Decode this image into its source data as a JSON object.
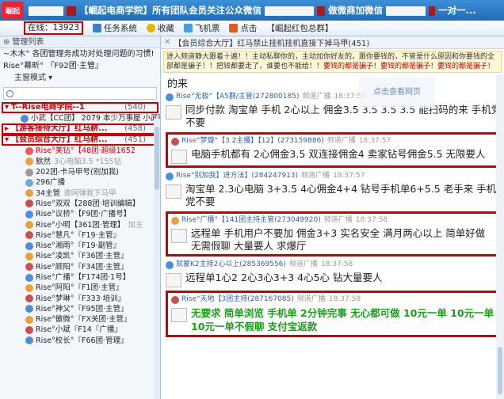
{
  "titlebar": {
    "logo_text": "崛起",
    "title_prefix": "【崛起电商学院】所有团队会员关注公众微信",
    "title_suffix": "做微商加微信",
    "title_tail": "一对一..."
  },
  "toolbar": {
    "online": "在线：13923",
    "items": [
      "任务系统",
      "收藏",
      "飞机票",
      "点击",
      "【崛起红包总群】"
    ]
  },
  "sidebar": {
    "header": "管理列表",
    "msg1": "~木木° 各团管理务成功对处理问题的习惯!",
    "msg2": "Rise°幕昕° 『F92团·主管』",
    "sort": "主窗模式 ▾",
    "search_placeholder": "",
    "groups": [
      {
        "name": "T--Rise电商学院--1",
        "count": "(540)"
      },
      {
        "name": "【游客接待大厅】红马耕...",
        "count": "(458)"
      },
      {
        "name": "【会员综合大厅】红马耕...",
        "count": "(451)"
      }
    ],
    "group0_sub": "小武【CC团】 2079  本少万事屋 小武歌",
    "members": [
      {
        "name": "Rise°美钻°【48团·超级1652",
        "desc": ""
      },
      {
        "name": "默然",
        "desc": "3心电脑3.5  *155钻 "
      },
      {
        "name": "202团-卡马甲号(别加我)",
        "desc": ""
      },
      {
        "name": "296广播",
        "desc": ""
      },
      {
        "name": "34主管",
        "desc": "谁网弹我下马甲"
      },
      {
        "name": "Rise°双双【288团·培训编辑】",
        "desc": ""
      },
      {
        "name": "Rise°议桥°【F9团·广播号】",
        "desc": ""
      },
      {
        "name": "Rise°小明【361团·管理】",
        "desc": "加主"
      },
      {
        "name": "Rise°慧凡°『F19·主管』",
        "desc": ""
      },
      {
        "name": "Rise°湘雨°『F19·副管』",
        "desc": ""
      },
      {
        "name": "Rise°凌凯°『F36团·主管』",
        "desc": ""
      },
      {
        "name": "Rise°顾阳°『F34团·主管』",
        "desc": ""
      },
      {
        "name": "Rise°广播°【F174团·1号】",
        "desc": ""
      },
      {
        "name": "Rise°阿阳°『F1团·主管』",
        "desc": ""
      },
      {
        "name": "Rise°梦琳°『F333·培训』",
        "desc": ""
      },
      {
        "name": "Rise°神父°『F95团·主管』",
        "desc": ""
      },
      {
        "name": "Rise°徽微°『FX关团·主管』",
        "desc": ""
      },
      {
        "name": "Rise°小斌『F14『广播』",
        "desc": ""
      },
      {
        "name": "Rise°校长°『F66团·管理』",
        "desc": ""
      }
    ]
  },
  "main": {
    "tab": "【会员综合大厅】红马禁止挂机挂机直接下掉马甲(451)",
    "notice_line1": "进入频道静大跟着十遍！！主动私聊你的，主动加你好友的，跟你要钱的，不管是什么原因和你要钱的全部都是骗子！！把钱都要走了，谁要也不能给！！",
    "notice_red": "要钱的都是骗子！要钱的都是骗子！要钱的都是骗子！切记",
    "watermark": "点击查看网页",
    "top_fragment": "的来",
    "messages": [
      {
        "sender": "Rise°无极°【A5群/主管(272800185)",
        "channel": "频道广播",
        "time": "18:37:56",
        "text": "同步付款 淘宝单 手机 2心以上 佣金3.5 3.5 3.5 3.5  能扫码的来 手机党不要",
        "highlight": false,
        "green": false
      },
      {
        "sender": "Rise°梦璇°【3.2主播】【12】(273159886)",
        "channel": "频道广播",
        "time": "18:37:57",
        "text": "电脑手机都有  2心佣金3.5  双连接佣金4  卖家钻号佣金5.5  无限要人",
        "highlight": true,
        "green": false
      },
      {
        "sender": "Rise°别加我】进方法】(284247913)",
        "channel": "频道广播",
        "time": "18:37:57",
        "text": "淘宝单           2.3心电脑 3+3.5  4心佣金4+4      钻号手机单6+5.5  老手来   手机党不要",
        "highlight": false,
        "green": false
      },
      {
        "sender": "Rise°广播°【141团主持主管(273049920)",
        "channel": "频道广播",
        "time": "18:37:58",
        "text": "远程单 手机用户不要加 佣金3+3 实名安全 满月两心以上 简单好做 无需假聊 大量要人 求爆厅",
        "highlight": true,
        "green": false
      },
      {
        "sender": "就蒙K2主持2心以上(285369556)",
        "channel": "频道广播",
        "time": "18:37:58",
        "text": "远程单1心2 2心3心3+3 4心5心 钻大量要人",
        "highlight": false,
        "green": false
      },
      {
        "sender": "Rise°天地【3团主持(287167085)",
        "channel": "频道广播",
        "time": "18:37:58",
        "text": "无要求 简单浏览 手机单 2分钟完事 无心都可做 10元一单 10元一单 10元一单不假聊 支付宝返款",
        "highlight": true,
        "green": true
      }
    ]
  },
  "colors": {
    "brand_red": "#c00000",
    "title_blue": "#1f6cb8",
    "green_text": "#1a9e1a"
  }
}
